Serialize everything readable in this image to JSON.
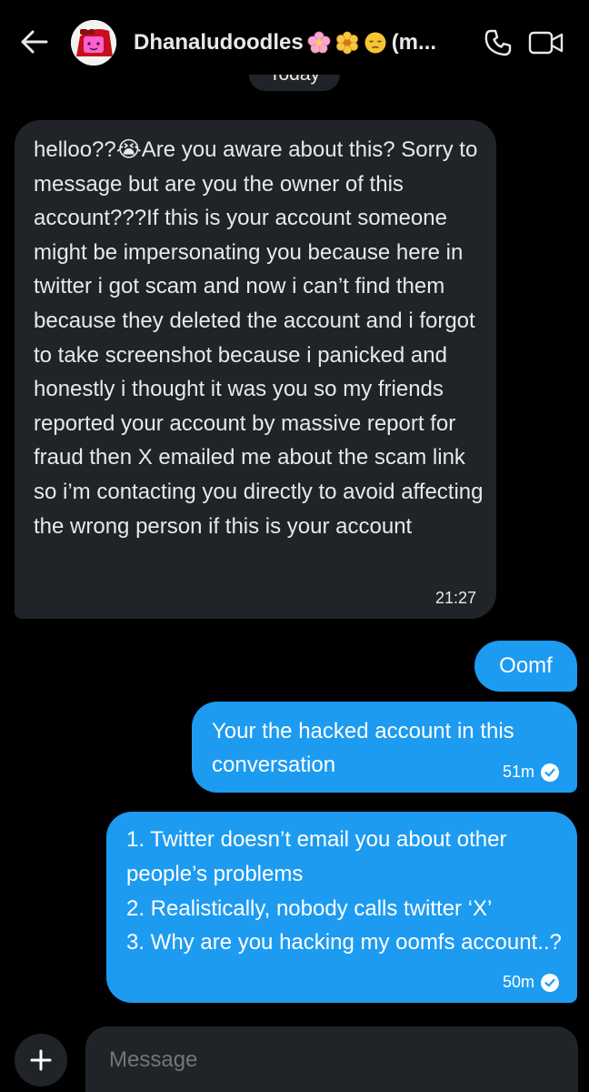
{
  "header": {
    "contact_name": "Dhanaludoodles",
    "name_suffix": "(m...",
    "date_label": "Today"
  },
  "icons": {
    "back": "arrow-left-icon",
    "call": "phone-icon",
    "video": "video-camera-icon",
    "add": "plus-icon",
    "sent_check": "check-circle-icon"
  },
  "messages": [
    {
      "direction": "incoming",
      "text": "helloo??😭Are you aware about this? Sorry to message but are you the owner of this account???If this is your account someone might be impersonating you because here in twitter i got scam and now i can’t find them because they deleted the account and i forgot to take screenshot because i panicked and honestly i thought it was you so my friends reported your account by massive report for fraud then X emailed me about the scam link so i’m contacting you directly to avoid affecting the wrong person if this is your account",
      "time": "21:27"
    },
    {
      "direction": "outgoing",
      "text": "Oomf"
    },
    {
      "direction": "outgoing",
      "text": "Your the hacked account in this conversation",
      "time": "51m"
    },
    {
      "direction": "outgoing",
      "lines": [
        "1. Twitter doesn’t email you about other people’s problems",
        "2. Realistically, nobody calls twitter ‘X’",
        "3. Why are you hacking my oomfs account..?"
      ],
      "time": "50m"
    }
  ],
  "composer": {
    "placeholder": "Message"
  },
  "colors": {
    "background": "#000000",
    "incoming_bubble": "#202327",
    "outgoing_bubble": "#1d9bf0",
    "text": "#e7e9ea",
    "placeholder": "#71767b"
  }
}
